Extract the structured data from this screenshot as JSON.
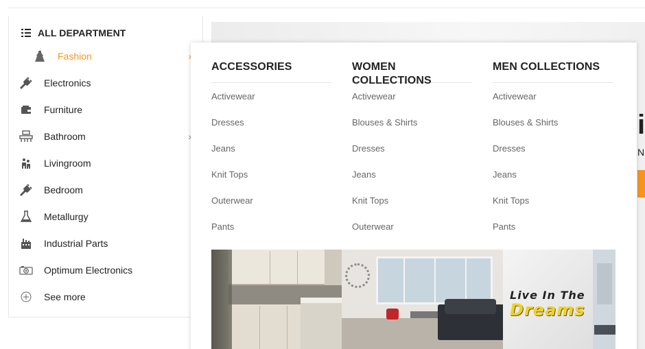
{
  "sidebar": {
    "header": "ALL DEPARTMENT",
    "items": [
      {
        "label": "Fashion",
        "icon": "dress-icon",
        "active": true,
        "has_submenu": true
      },
      {
        "label": "Electronics",
        "icon": "plug-icon",
        "has_submenu": false
      },
      {
        "label": "Furniture",
        "icon": "wallet-icon",
        "has_submenu": false
      },
      {
        "label": "Bathroom",
        "icon": "bathtub-icon",
        "has_submenu": true
      },
      {
        "label": "Livingroom",
        "icon": "family-icon",
        "has_submenu": false
      },
      {
        "label": "Bedroom",
        "icon": "plug-icon",
        "has_submenu": false
      },
      {
        "label": "Metallurgy",
        "icon": "flask-icon",
        "has_submenu": false
      },
      {
        "label": "Industrial Parts",
        "icon": "factory-icon",
        "has_submenu": false
      },
      {
        "label": "Optimum Electronics",
        "icon": "camera-icon",
        "has_submenu": false
      },
      {
        "label": "See more",
        "icon": "plus-circle-icon",
        "has_submenu": false
      }
    ],
    "arrow_glyph": "›"
  },
  "mega_menu": {
    "columns": [
      {
        "title": "ACCESSORIES",
        "links": [
          "Activewear",
          "Dresses",
          "Jeans",
          "Knit Tops",
          "Outerwear",
          "Pants"
        ]
      },
      {
        "title": "WOMEN COLLECTIONS",
        "links": [
          "Activewear",
          "Blouses & Shirts",
          "Dresses",
          "Jeans",
          "Knit Tops",
          "Outerwear"
        ]
      },
      {
        "title": "MEN COLLECTIONS",
        "links": [
          "Activewear",
          "Blouses & Shirts",
          "Dresses",
          "Jeans",
          "Knit Tops",
          "Pants"
        ]
      }
    ],
    "promo": {
      "line1": "Live In The",
      "line2": "Dreams"
    }
  },
  "colors": {
    "accent": "#f7941d",
    "promo_text": "#f3d21b"
  }
}
